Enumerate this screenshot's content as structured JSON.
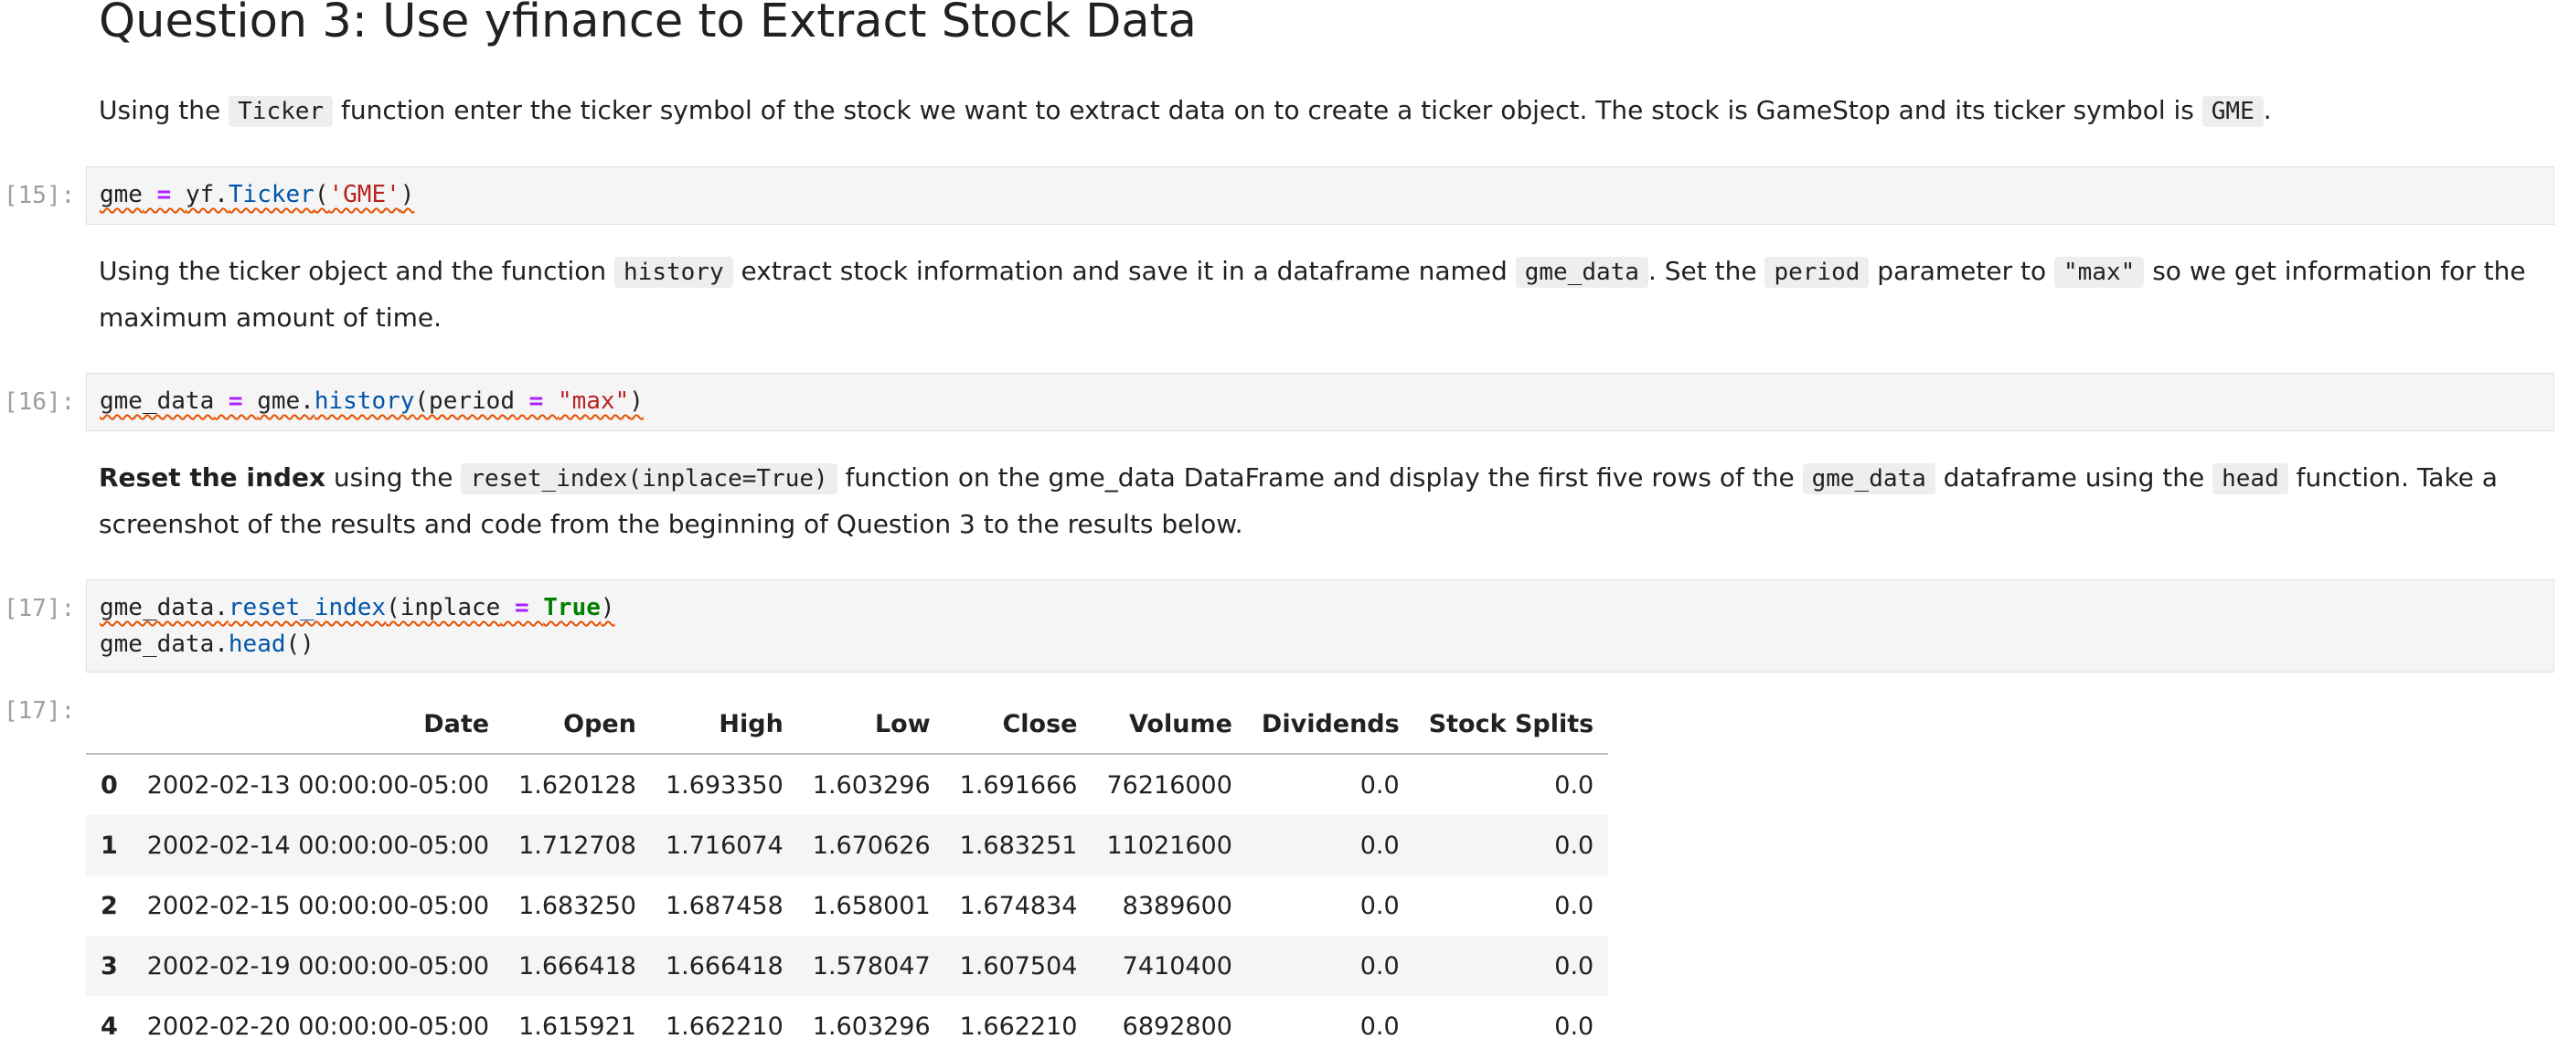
{
  "heading": "Question 3: Use yfinance to Extract Stock Data",
  "para1": {
    "t1": "Using the ",
    "c1": "Ticker",
    "t2": " function enter the ticker symbol of the stock we want to extract data on to create a ticker object. The stock is GameStop and its ticker symbol is ",
    "c2": "GME",
    "t3": "."
  },
  "cell15": {
    "prompt": "[15]:",
    "line1": {
      "a": "gme",
      "op": " = ",
      "b": "yf.",
      "fn": "Ticker",
      "c": "(",
      "str": "'GME'",
      "d": ")"
    }
  },
  "para2": {
    "t1": "Using the ticker object and the function ",
    "c1": "history",
    "t2": " extract stock information and save it in a dataframe named ",
    "c2": "gme_data",
    "t3": ". Set the ",
    "c3": "period",
    "t4": " parameter to ",
    "c4": "\"max\"",
    "t5": " so we get information for the maximum amount of time."
  },
  "cell16": {
    "prompt": "[16]:",
    "line1": {
      "a": "gme_data",
      "op": " = ",
      "b": "gme.",
      "fn": "history",
      "c": "(period",
      "op2": " = ",
      "str": "\"max\"",
      "d": ")"
    }
  },
  "para3": {
    "bold": "Reset the index",
    "t1": " using the ",
    "c1": "reset_index(inplace=True)",
    "t2": " function on the gme_data DataFrame and display the first five rows of the ",
    "c2": "gme_data",
    "t3": " dataframe using the ",
    "c3": "head",
    "t4": " function. Take a screenshot of the results and code from the beginning of Question 3 to the results below."
  },
  "cell17": {
    "prompt": "[17]:",
    "line1": {
      "a": "gme_data.",
      "fn": "reset_index",
      "c": "(inplace",
      "op": " = ",
      "kw": "True",
      "d": ")"
    },
    "line2": {
      "a": "gme_data.",
      "fn": "head",
      "c": "()"
    }
  },
  "output17": {
    "prompt": "[17]:",
    "columns": [
      "",
      "Date",
      "Open",
      "High",
      "Low",
      "Close",
      "Volume",
      "Dividends",
      "Stock Splits"
    ],
    "rows": [
      [
        "0",
        "2002-02-13 00:00:00-05:00",
        "1.620128",
        "1.693350",
        "1.603296",
        "1.691666",
        "76216000",
        "0.0",
        "0.0"
      ],
      [
        "1",
        "2002-02-14 00:00:00-05:00",
        "1.712708",
        "1.716074",
        "1.670626",
        "1.683251",
        "11021600",
        "0.0",
        "0.0"
      ],
      [
        "2",
        "2002-02-15 00:00:00-05:00",
        "1.683250",
        "1.687458",
        "1.658001",
        "1.674834",
        "8389600",
        "0.0",
        "0.0"
      ],
      [
        "3",
        "2002-02-19 00:00:00-05:00",
        "1.666418",
        "1.666418",
        "1.578047",
        "1.607504",
        "7410400",
        "0.0",
        "0.0"
      ],
      [
        "4",
        "2002-02-20 00:00:00-05:00",
        "1.615921",
        "1.662210",
        "1.603296",
        "1.662210",
        "6892800",
        "0.0",
        "0.0"
      ]
    ]
  }
}
